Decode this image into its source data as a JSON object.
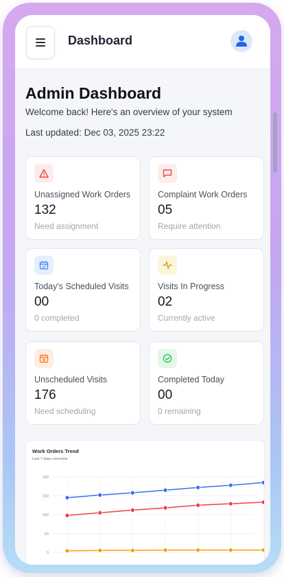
{
  "topbar": {
    "title": "Dashboard",
    "menu_icon": "hamburger-icon",
    "avatar_icon": "user-icon"
  },
  "header": {
    "title": "Admin Dashboard",
    "subtitle": "Welcome back! Here's an overview of your system",
    "last_updated": "Last updated: Dec 03, 2025 23:22"
  },
  "cards": [
    {
      "label": "Unassigned Work Orders",
      "value": "132",
      "note": "Need assignment",
      "icon": "warning-triangle-icon",
      "color": "#ef4444",
      "bg": "#fdecec"
    },
    {
      "label": "Complaint Work Orders",
      "value": "05",
      "note": "Require attention",
      "icon": "message-square-icon",
      "color": "#ef4444",
      "bg": "#fdecec"
    },
    {
      "label": "Today's Scheduled Visits",
      "value": "00",
      "note": "0 completed",
      "icon": "calendar-check-icon",
      "color": "#3b82f6",
      "bg": "#e6effc"
    },
    {
      "label": "Visits In Progress",
      "value": "02",
      "note": "Currently active",
      "icon": "activity-icon",
      "color": "#d4a017",
      "bg": "#fbf5dc"
    },
    {
      "label": "Unscheduled Visits",
      "value": "176",
      "note": "Need scheduling",
      "icon": "calendar-x-icon",
      "color": "#f97316",
      "bg": "#fdeee3"
    },
    {
      "label": "Completed Today",
      "value": "00",
      "note": "0 remaining",
      "icon": "check-circle-icon",
      "color": "#22c55e",
      "bg": "#e6f6ea"
    }
  ],
  "chart_data": {
    "type": "line",
    "title": "Work Orders Trend",
    "subtitle": "Last 7 days overview",
    "ylim": [
      0,
      200
    ],
    "yticks": [
      "200",
      "150",
      "100",
      "50",
      "0"
    ],
    "grid": true,
    "series": [
      {
        "color": "#3b6ef5",
        "values": [
          145,
          152,
          158,
          165,
          172,
          178,
          185
        ]
      },
      {
        "color": "#ef3e4a",
        "values": [
          98,
          105,
          112,
          118,
          125,
          129,
          133
        ]
      },
      {
        "color": "#f59e0b",
        "values": [
          4,
          5,
          5,
          6,
          6,
          6,
          6
        ]
      }
    ]
  }
}
